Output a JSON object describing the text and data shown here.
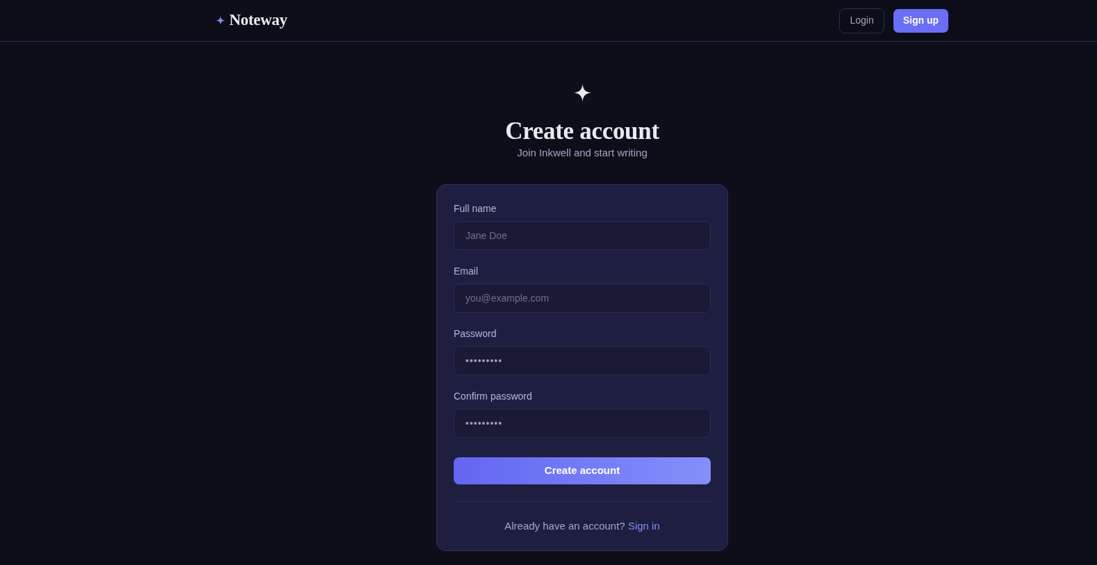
{
  "header": {
    "logo": "Noteway",
    "nav_buttons": [
      {
        "label": "Login",
        "kind": "outline"
      },
      {
        "label": "Sign up",
        "kind": "primary"
      }
    ]
  },
  "hero": {
    "title": "Create account",
    "subtitle": "Join Inkwell and start writing"
  },
  "form": {
    "fields": [
      {
        "label": "Full name",
        "placeholder": "Jane Doe"
      },
      {
        "label": "Email",
        "placeholder": "you@example.com"
      },
      {
        "label": "Password",
        "value": "•••••••••"
      },
      {
        "label": "Confirm password",
        "value": "•••••••••"
      }
    ],
    "submit": "Create account",
    "footer": {
      "text": "Already have an account?",
      "link": "Sign in"
    }
  }
}
